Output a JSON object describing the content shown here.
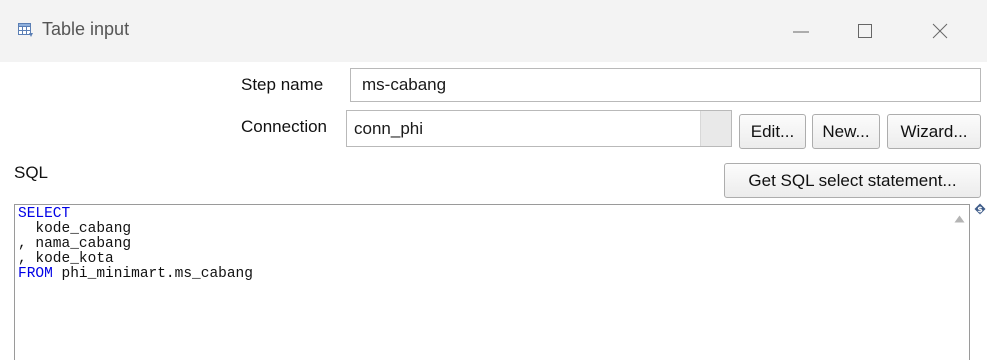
{
  "window": {
    "title": "Table input",
    "icons": {
      "app": "table-grid-icon",
      "minimize": "minimize-icon",
      "maximize": "maximize-icon",
      "close": "close-icon"
    }
  },
  "form": {
    "step_name_label": "Step name",
    "step_name_value": "ms-cabang",
    "connection_label": "Connection",
    "connection_value": "conn_phi",
    "edit_button": "Edit...",
    "new_button": "New...",
    "wizard_button": "Wizard...",
    "sql_label": "SQL",
    "get_sql_button": "Get SQL select statement..."
  },
  "sql_editor": {
    "lines": [
      {
        "keyword": "SELECT",
        "text": ""
      },
      {
        "keyword": "",
        "text": "  kode_cabang"
      },
      {
        "keyword": "",
        "text": ", nama_cabang"
      },
      {
        "keyword": "",
        "text": ", kode_kota"
      },
      {
        "keyword": "FROM",
        "text": " phi_minimart.ms_cabang"
      }
    ],
    "keyword_color": "#0000e6",
    "variable_indicator_icon": "variable-diamond-icon"
  }
}
